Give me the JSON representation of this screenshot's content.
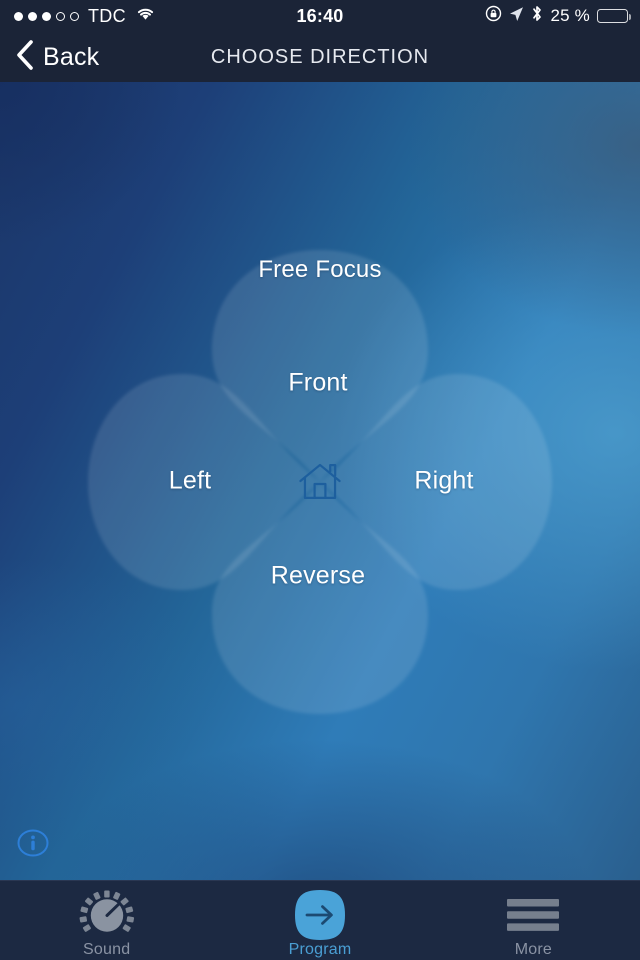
{
  "status_bar": {
    "signal_dots_filled": 3,
    "signal_dots_total": 5,
    "carrier": "TDC",
    "wifi_icon": "wifi-icon",
    "time": "16:40",
    "rotation_lock_icon": "rotation-lock-icon",
    "location_icon": "location-arrow-icon",
    "bluetooth_icon": "bluetooth-icon",
    "battery_percent": "25 %",
    "battery_level": 25,
    "battery_icon": "battery-icon"
  },
  "nav_bar": {
    "back_icon": "chevron-left-icon",
    "back_label": "Back",
    "title": "CHOOSE DIRECTION"
  },
  "main": {
    "free_focus_label": "Free Focus",
    "center_icon": "home-icon",
    "directions": [
      {
        "id": "front",
        "label": "Front"
      },
      {
        "id": "right",
        "label": "Right"
      },
      {
        "id": "reverse",
        "label": "Reverse"
      },
      {
        "id": "left",
        "label": "Left"
      }
    ],
    "info_icon": "info-circle-icon"
  },
  "tab_bar": {
    "tabs": [
      {
        "id": "sound",
        "label": "Sound",
        "icon": "volume-knob-icon",
        "active": false
      },
      {
        "id": "program",
        "label": "Program",
        "icon": "arrow-right-icon",
        "active": true
      },
      {
        "id": "more",
        "label": "More",
        "icon": "hamburger-menu-icon",
        "active": false
      }
    ]
  },
  "colors": {
    "chrome": "#1b2437",
    "tabbar": "#1c2942",
    "accent": "#4a9fd4",
    "petal": "#ffffff",
    "text": "#ffffff",
    "inactive": "#8a93a4"
  }
}
